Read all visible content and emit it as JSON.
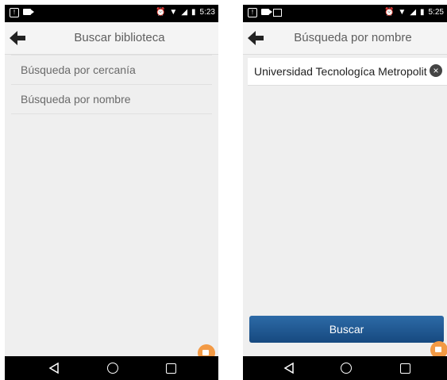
{
  "screen_left": {
    "status": {
      "time": "5:23"
    },
    "title": "Buscar biblioteca",
    "options": [
      "Búsqueda por cercanía",
      "Búsqueda por nombre"
    ]
  },
  "screen_right": {
    "status": {
      "time": "5:25"
    },
    "title": "Búsqueda por nombre",
    "search_value": "Universidad Tecnologíca Metropolitana",
    "button_label": "Buscar"
  },
  "icons": {
    "back": "arrow-left-icon",
    "clear": "close-circle-icon",
    "fab": "video-camera-icon"
  },
  "colors": {
    "status_bar": "#000000",
    "primary_button": "#1f5a95",
    "fab": "#f39a45",
    "background": "#efefef"
  }
}
